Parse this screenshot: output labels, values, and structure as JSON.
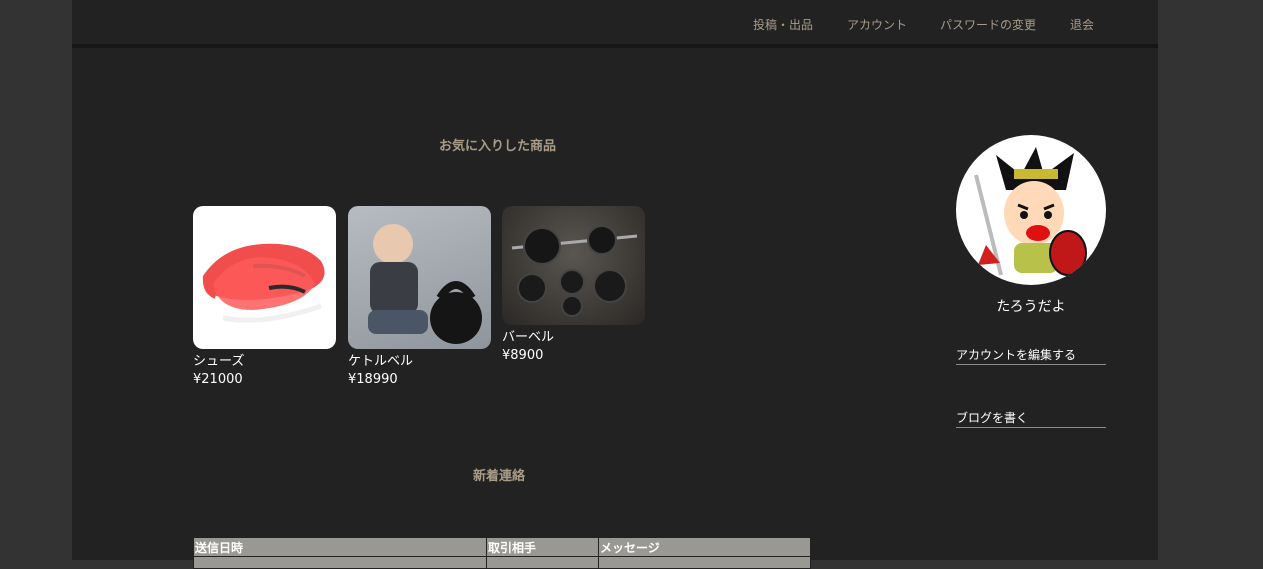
{
  "nav": {
    "post": "投稿・出品",
    "account": "アカウント",
    "password": "パスワードの変更",
    "withdraw": "退会"
  },
  "favorites": {
    "title": "お気に入りした商品",
    "items": [
      {
        "name": "シューズ",
        "price": "¥21000"
      },
      {
        "name": "ケトルベル",
        "price": "¥18990"
      },
      {
        "name": "バーベル",
        "price": "¥8900"
      }
    ]
  },
  "messages": {
    "title": "新着連絡",
    "columns": [
      "送信日時",
      "取引相手",
      "メッセージ"
    ]
  },
  "sidebar": {
    "username": "たろうだよ",
    "edit_account": "アカウントを編集する",
    "write_blog": "ブログを書く"
  },
  "colors": {
    "background": "#222222",
    "outer": "#333333",
    "accent": "#a89c88",
    "table_header": "#9a9893"
  }
}
